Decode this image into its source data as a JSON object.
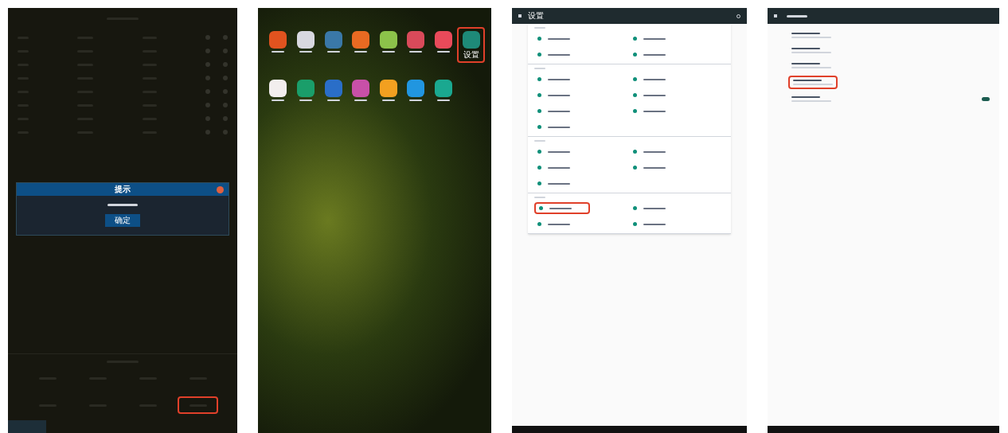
{
  "screens": [
    {
      "kind": "dark_app",
      "dialog": {
        "title": "提示",
        "button": "确定"
      },
      "options": [
        {
          "selected": false
        },
        {
          "selected": false
        },
        {
          "selected": false
        },
        {
          "selected": false
        },
        {
          "selected": false
        },
        {
          "selected": false
        },
        {
          "selected": false
        },
        {
          "selected": true
        }
      ]
    },
    {
      "kind": "home",
      "apps": [
        {
          "color": "#e0531f",
          "selected": false
        },
        {
          "color": "#d8d8e0",
          "selected": false
        },
        {
          "color": "#3a78a8",
          "selected": false
        },
        {
          "color": "#e86a22",
          "selected": false
        },
        {
          "color": "#8cc24a",
          "selected": false
        },
        {
          "color": "#d94a5a",
          "selected": false
        },
        {
          "color": "#e84a5a",
          "selected": false
        },
        {
          "color": "#1e8a78",
          "selected": true
        },
        {
          "color": "#f2eeee",
          "selected": false
        },
        {
          "color": "#1a9e6a",
          "selected": false
        },
        {
          "color": "#2a6ec8",
          "selected": false
        },
        {
          "color": "#c850a8",
          "selected": false
        },
        {
          "color": "#f2a020",
          "selected": false
        },
        {
          "color": "#2196e0",
          "selected": false
        },
        {
          "color": "#1aa890",
          "selected": false
        }
      ],
      "selected_label": "设置"
    },
    {
      "kind": "settings",
      "title": "设置",
      "sections": [
        {
          "rows": [
            {
              "selected": false
            },
            {
              "selected": false
            },
            {
              "selected": false
            },
            {
              "selected": false
            }
          ]
        },
        {
          "rows": [
            {
              "selected": false
            },
            {
              "selected": false
            },
            {
              "selected": false
            },
            {
              "selected": false
            },
            {
              "selected": false
            },
            {
              "selected": false
            },
            {
              "selected": false
            }
          ]
        },
        {
          "rows": [
            {
              "selected": false
            },
            {
              "selected": false
            },
            {
              "selected": false
            },
            {
              "selected": false
            },
            {
              "selected": false
            }
          ]
        },
        {
          "rows": [
            {
              "selected": true
            },
            {
              "selected": false
            },
            {
              "selected": false
            },
            {
              "selected": false
            }
          ]
        }
      ]
    },
    {
      "kind": "settings_detail",
      "rows": [
        {
          "kind": "text",
          "selected": false
        },
        {
          "kind": "text",
          "selected": false
        },
        {
          "kind": "text",
          "selected": false
        },
        {
          "kind": "text",
          "selected": true
        },
        {
          "kind": "toggle",
          "selected": false,
          "on": true
        }
      ]
    }
  ]
}
